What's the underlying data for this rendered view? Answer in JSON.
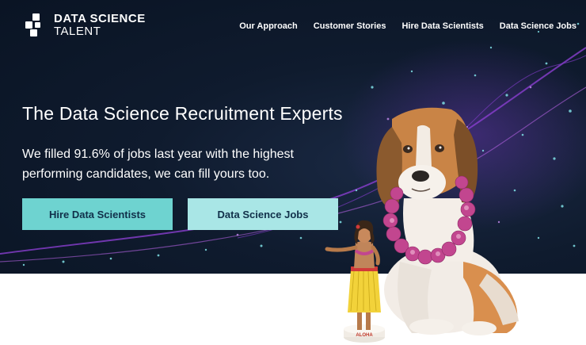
{
  "brand": {
    "name_line1": "DATA SCIENCE",
    "name_line2": "TALENT"
  },
  "nav": {
    "items": [
      {
        "label": "Our Approach"
      },
      {
        "label": "Customer Stories"
      },
      {
        "label": "Hire Data Scientists"
      },
      {
        "label": "Data Science Jobs"
      }
    ]
  },
  "hero": {
    "headline": "The Data Science Recruitment Experts",
    "subhead": "We filled 91.6% of jobs last year with the highest performing candidates, we can fill yours too.",
    "primary_button": "Hire Data Scientists",
    "secondary_button": "Data Science Jobs"
  },
  "figurine": {
    "label": "ALOHA"
  },
  "colors": {
    "hero_bg": "#0f1b2e",
    "button_primary": "#6ed3d0",
    "button_secondary": "#a9e6e6",
    "particle_purple": "#9b4fd6",
    "lei_pink": "#c2468f"
  }
}
